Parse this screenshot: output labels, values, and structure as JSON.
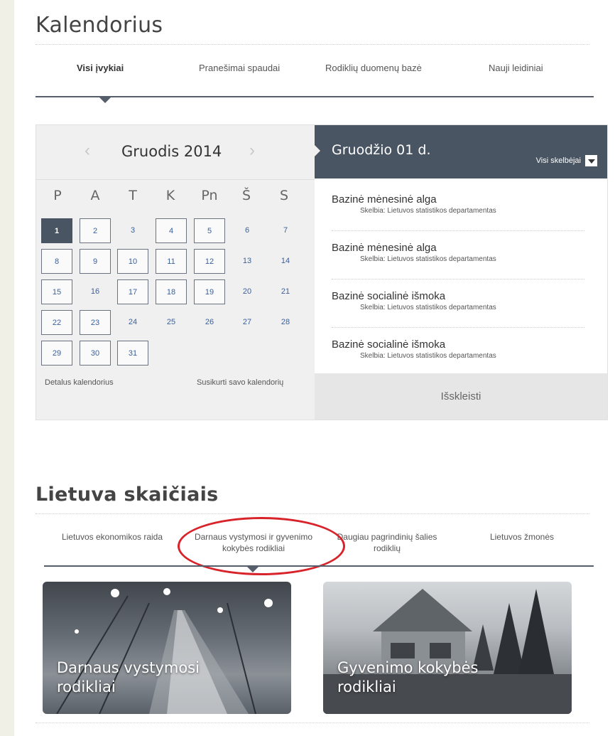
{
  "calendar_section": {
    "title": "Kalendorius",
    "tabs": [
      {
        "label": "Visi įvykiai"
      },
      {
        "label": "Pranešimai spaudai"
      },
      {
        "label": "Rodiklių duomenų bazė"
      },
      {
        "label": "Nauji leidiniai"
      }
    ],
    "month_label": "Gruodis 2014",
    "prev": "‹",
    "next": "›",
    "weekdays": [
      "P",
      "A",
      "T",
      "K",
      "Pn",
      "Š",
      "S"
    ],
    "links": {
      "detailed": "Detalus kalendorius",
      "create": "Susikurti savo kalendorių"
    },
    "selected_date": "Gruodžio 01 d.",
    "filter_label": "Visi skelbėjai",
    "events": [
      {
        "title": "Bazinė mėnesinė alga",
        "source": "Skelbia: Lietuvos statistikos departamentas"
      },
      {
        "title": "Bazinė mėnesinė alga",
        "source": "Skelbia: Lietuvos statistikos departamentas"
      },
      {
        "title": "Bazinė socialinė išmoka",
        "source": "Skelbia: Lietuvos statistikos departamentas"
      },
      {
        "title": "Bazinė socialinė išmoka",
        "source": "Skelbia: Lietuvos statistikos departamentas"
      }
    ],
    "expand_label": "Išskleisti"
  },
  "lietuva_section": {
    "title": "Lietuva skaičiais",
    "tabs": [
      {
        "label": "Lietuvos ekonomikos raida"
      },
      {
        "label": "Darnaus vystymosi ir gyvenimo kokybės rodikliai"
      },
      {
        "label": "Daugiau pagrindinių šalies rodiklių"
      },
      {
        "label": "Lietuvos žmonės"
      }
    ],
    "cards": [
      {
        "caption_line1": "Darnaus vystymosi",
        "caption_line2": "rodikliai"
      },
      {
        "caption_line1": "Gyvenimo kokybės",
        "caption_line2": "rodikliai"
      }
    ]
  },
  "colors": {
    "accent": "#4a5563",
    "highlight_ellipse": "#d8232a",
    "day_link": "#3a5f9a"
  }
}
